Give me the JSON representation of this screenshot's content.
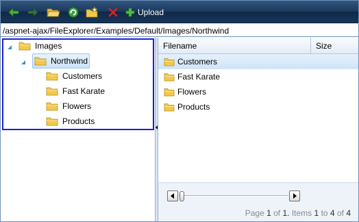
{
  "toolbar": {
    "buttons": [
      {
        "icon": "back-arrow-icon",
        "color": "#4caf3c"
      },
      {
        "icon": "forward-arrow-icon",
        "color": "#3e8a36"
      },
      {
        "icon": "open-folder-icon",
        "color": "#f0c040"
      },
      {
        "icon": "refresh-icon",
        "color": "#3aa33a"
      },
      {
        "icon": "new-folder-icon",
        "color": "#f0c040"
      },
      {
        "icon": "delete-icon",
        "color": "#e02020"
      }
    ],
    "upload_label": "Upload",
    "background": "#1b3a5e"
  },
  "address": {
    "path": "/aspnet-ajax/FileExplorer/Examples/Default/Images/Northwind"
  },
  "tree": {
    "root": {
      "label": "Images",
      "expanded": true
    },
    "child": {
      "label": "Northwind",
      "expanded": true,
      "selected": true
    },
    "leaves": [
      {
        "label": "Customers"
      },
      {
        "label": "Fast Karate"
      },
      {
        "label": "Flowers"
      },
      {
        "label": "Products"
      }
    ],
    "focus_border_color": "#1a1fd0"
  },
  "grid": {
    "columns": [
      {
        "label": "Filename"
      },
      {
        "label": "Size"
      }
    ],
    "rows": [
      {
        "name": "Customers",
        "selected": true
      },
      {
        "name": "Fast Karate",
        "selected": false
      },
      {
        "name": "Flowers",
        "selected": false
      },
      {
        "name": "Products",
        "selected": false
      }
    ]
  },
  "pager": {
    "page_word": "Page",
    "page": "1",
    "of_word": "of",
    "page_count": "1.",
    "items_word": "Items",
    "item_from": "1",
    "to_word": "to",
    "item_to": "4",
    "item_total": "4"
  },
  "colors": {
    "folder": "#f2c94c",
    "selection": "#cfe4f6",
    "pane_border": "#6e8fb8"
  }
}
